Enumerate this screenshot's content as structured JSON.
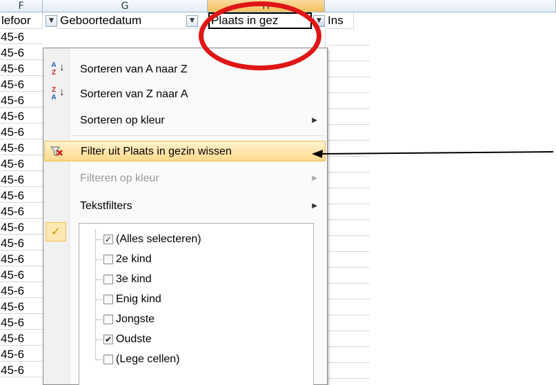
{
  "columns": {
    "f": "F",
    "g": "G",
    "h": "H"
  },
  "headers": {
    "f_partial": "lefoor",
    "g": "Geboortedatum",
    "h": "Plaats in gez",
    "next_partial": "Ins"
  },
  "row_values": [
    "45-6",
    "45-6",
    "45-6",
    "45-6",
    "45-6",
    "45-6",
    "45-6",
    "45-6",
    "45-6",
    "45-6",
    "45-6",
    "45-6",
    "45-6",
    "45-6",
    "45-6",
    "45-6",
    "45-6",
    "45-6",
    "45-6",
    "45-6",
    "45-6",
    "45-6"
  ],
  "menu": {
    "sort_az": "Sorteren van A naar Z",
    "sort_za": "Sorteren van Z naar A",
    "sort_color": "Sorteren op kleur",
    "clear_filter": "Filter uit Plaats in gezin wissen",
    "filter_color": "Filteren op kleur",
    "text_filters": "Tekstfilters"
  },
  "icons": {
    "sort_az_top": "A",
    "sort_az_bottom": "Z",
    "sort_za_top": "Z",
    "sort_za_bottom": "A",
    "down_arrow": "↓",
    "submenu_arrow": "▶",
    "clear_filter": "clear-filter-icon",
    "checkmark": "✓",
    "dropdown": "▼"
  },
  "filter_list": [
    {
      "label": "(Alles selecteren)",
      "checked": "partial"
    },
    {
      "label": "2e kind",
      "checked": "false"
    },
    {
      "label": "3e kind",
      "checked": "false"
    },
    {
      "label": "Enig kind",
      "checked": "false"
    },
    {
      "label": "Jongste",
      "checked": "false"
    },
    {
      "label": "Oudste",
      "checked": "true"
    },
    {
      "label": "(Lege cellen)",
      "checked": "false"
    }
  ],
  "check_marks": {
    "partial": "✓",
    "checked": "✔"
  },
  "colors": {
    "highlight": "#ffd98a",
    "annotation": "#e01515"
  }
}
